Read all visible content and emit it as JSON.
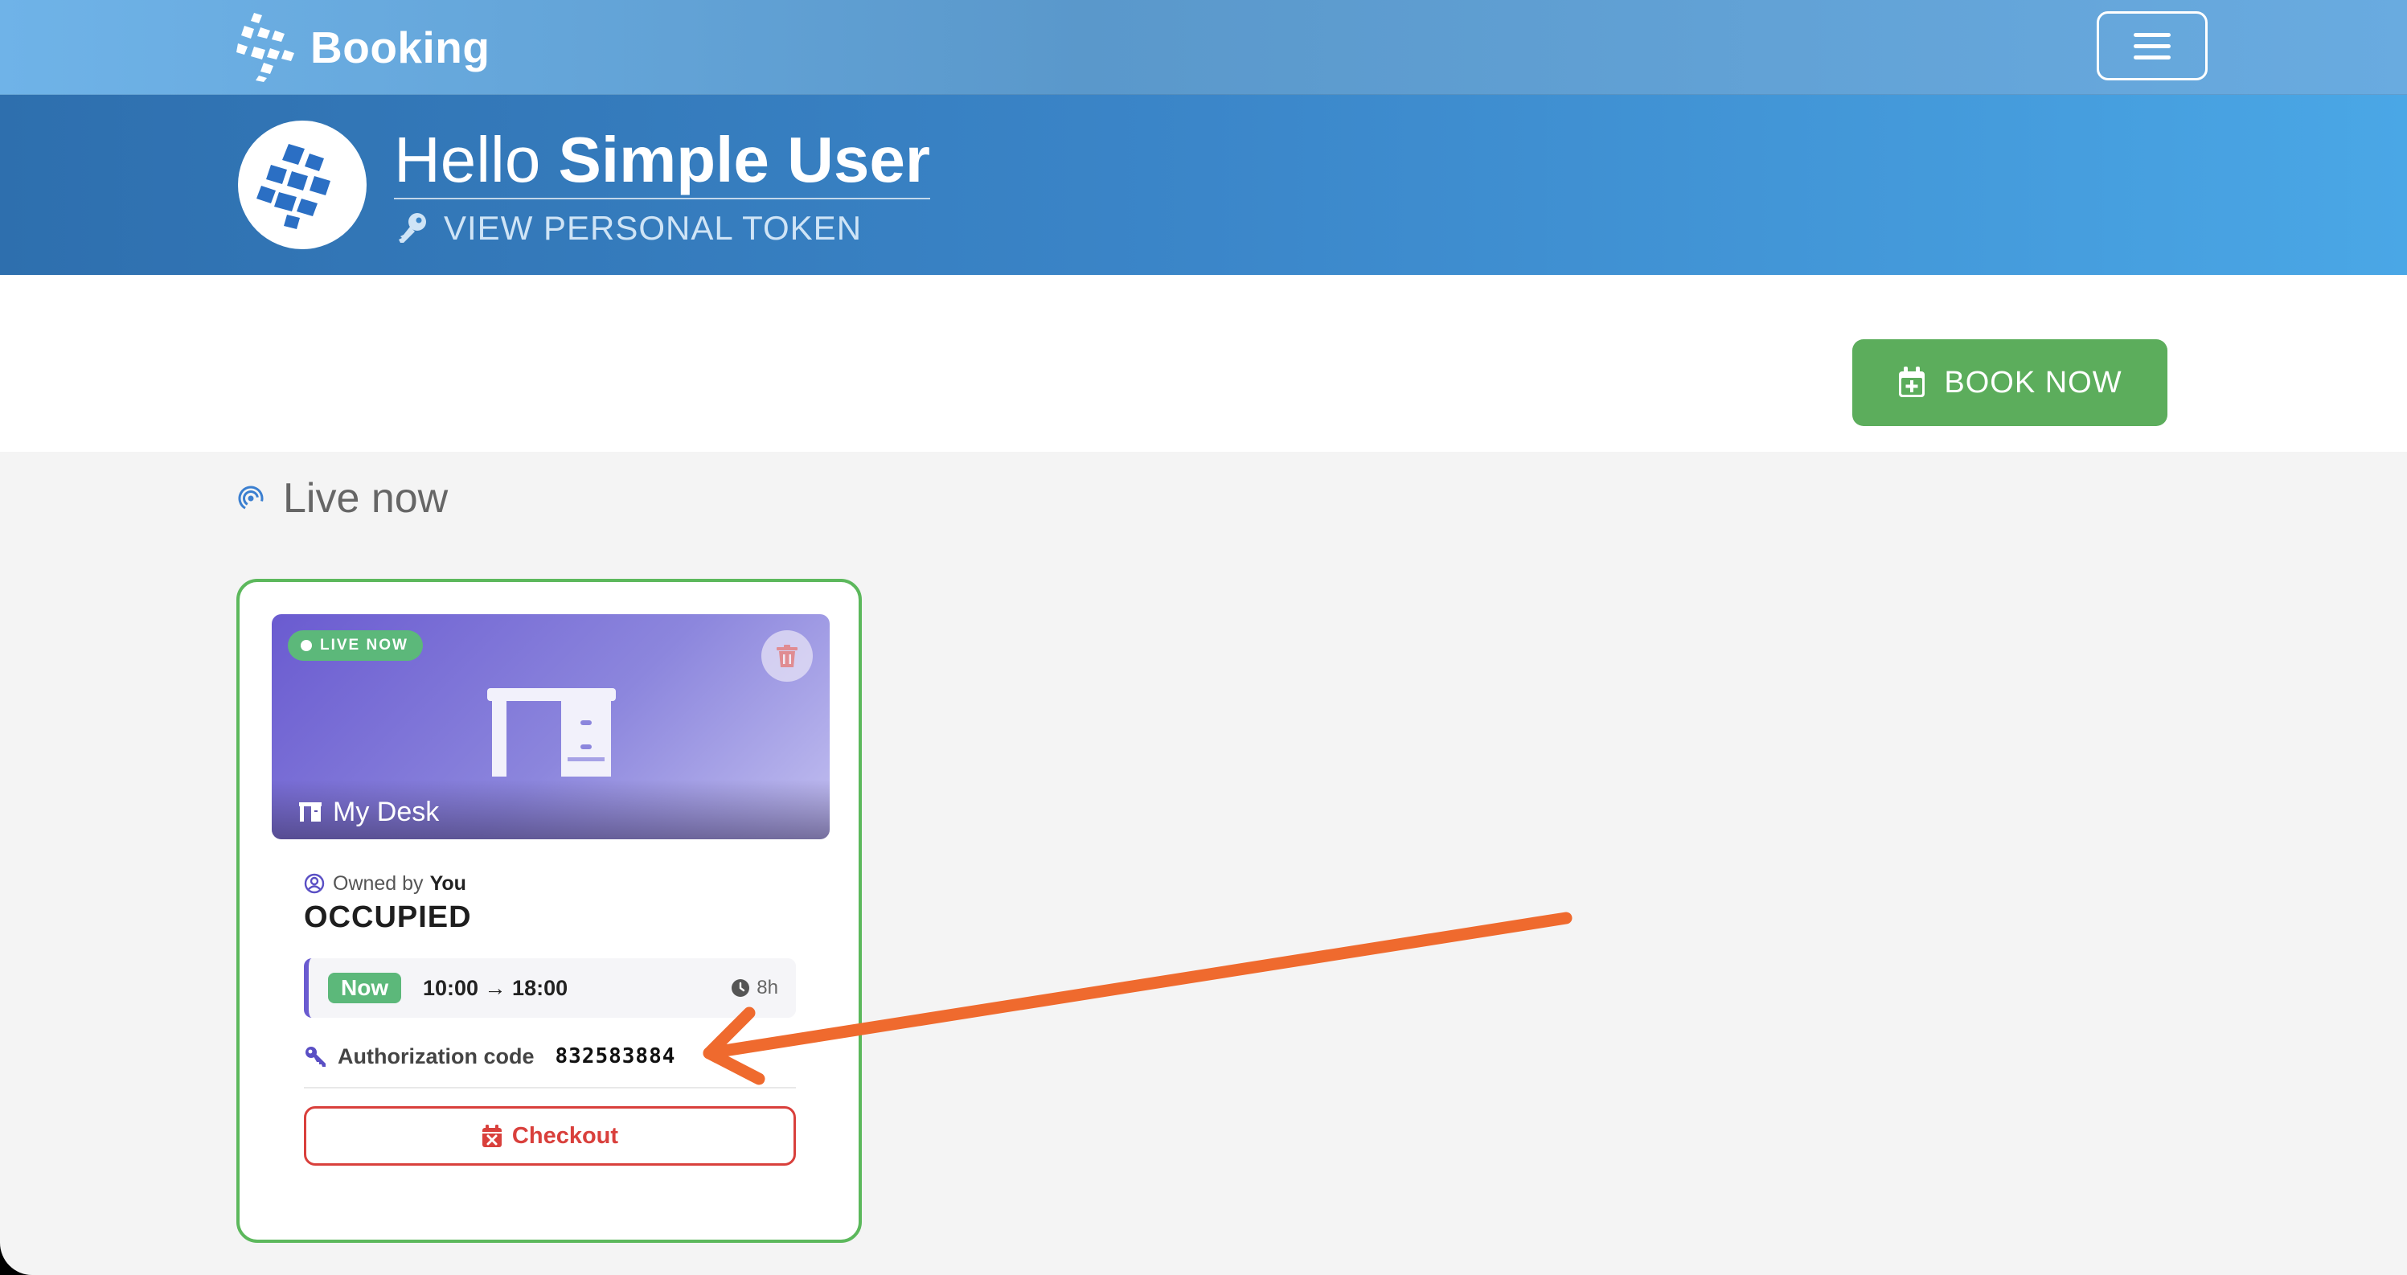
{
  "navbar": {
    "brand_name": "Booking",
    "menu_icon": "hamburger-menu-icon"
  },
  "hero": {
    "greeting_hello": "Hello",
    "user_name": "Simple User",
    "token_link_label": "VIEW PERSONAL TOKEN",
    "token_icon": "key-icon"
  },
  "actions": {
    "book_now_label": "BOOK NOW",
    "book_now_icon": "calendar-plus-icon"
  },
  "live_section": {
    "title": "Live now",
    "title_icon": "broadcast-icon"
  },
  "booking_card": {
    "live_badge": "LIVE NOW",
    "resource_name": "My Desk",
    "resource_icon": "desk-icon",
    "owner_label": "Owned by",
    "owner_name": "You",
    "status": "OCCUPIED",
    "slot": {
      "badge": "Now",
      "time": "10:00 → 18:00",
      "duration": "8h"
    },
    "auth_label": "Authorization code",
    "auth_code": "832583884",
    "checkout_label": "Checkout",
    "checkout_icon": "calendar-x-icon",
    "delete_icon": "trash-icon"
  },
  "colors": {
    "navbar": "#5a98cb",
    "hero": "#3b86c9",
    "book_now": "#5cad5c",
    "card_border": "#5cb85c",
    "live_badge": "#5cb87a",
    "checkout": "#d9403c",
    "annotation_arrow": "#ef6a2e"
  }
}
